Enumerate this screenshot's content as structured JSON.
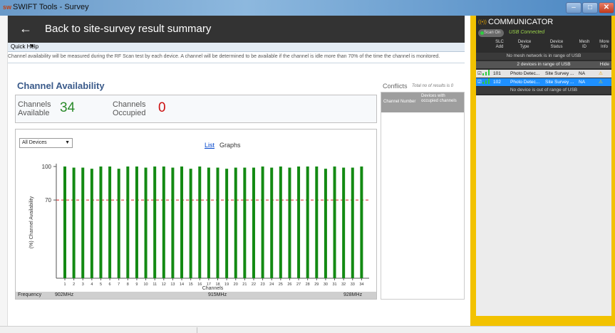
{
  "window": {
    "title": "SWIFT Tools - Survey",
    "app_icon": "swift-logo-icon"
  },
  "header": {
    "back_label": "Back to site-survey result summary",
    "back_icon": "arrow-left-icon"
  },
  "quick_help": {
    "label": "Quick Help",
    "help_text": "Channel availability will be measured during the RF Scan test by each device. A channel will be determined to be available if the channel is idle more than 70% of the time the channel is monitored."
  },
  "availability": {
    "title": "Channel Availability",
    "available_label": "Channels Available",
    "available_value": "34",
    "occupied_label": "Channels Occupied",
    "occupied_value": "0"
  },
  "conflicts": {
    "title": "Conflicts",
    "total_text": "Total no of results is 0",
    "col_channel": "Channel Number",
    "col_devices": "Devices with occupied channels"
  },
  "chart_controls": {
    "device_filter": "All Devices",
    "tab_list": "List",
    "tab_graphs": "Graphs"
  },
  "frequency": {
    "label": "Frequency",
    "start": "902MHz",
    "mid": "915MHz",
    "end": "928MHz"
  },
  "chart_data": {
    "type": "bar",
    "categories": [
      "1",
      "2",
      "3",
      "4",
      "5",
      "6",
      "7",
      "8",
      "9",
      "10",
      "11",
      "12",
      "13",
      "14",
      "15",
      "16",
      "17",
      "18",
      "19",
      "20",
      "21",
      "22",
      "23",
      "24",
      "25",
      "26",
      "27",
      "28",
      "29",
      "30",
      "31",
      "32",
      "33",
      "34"
    ],
    "values": [
      100,
      99,
      99,
      98,
      100,
      100,
      98,
      100,
      100,
      99,
      100,
      100,
      99,
      100,
      98,
      100,
      99,
      99,
      98,
      99,
      99,
      99,
      100,
      99,
      100,
      99,
      100,
      100,
      100,
      98,
      100,
      99,
      99,
      100
    ],
    "xlabel": "Channels",
    "ylabel": "(%) Channel Availability",
    "yticks": [
      100,
      70
    ],
    "threshold": 70,
    "ylim": [
      0,
      100
    ],
    "colors": {
      "bar": "#138a13",
      "threshold": "#d42020"
    }
  },
  "communicator": {
    "title": "COMMUNICATOR",
    "scan_label": "Scan On",
    "usb_status": "USB Connected",
    "columns": [
      "SLC Add",
      "Device Type",
      "Device Status",
      "Mesh ID",
      "More Info"
    ],
    "no_mesh_text": "No mesh network is in range of USB",
    "in_range_text": "2 devices in range of USB",
    "hide_label": "Hide",
    "devices": [
      {
        "slc": "101",
        "type": "Photo Detec...",
        "status": "Site Survey ...",
        "mesh": "NA"
      },
      {
        "slc": "102",
        "type": "Photo Detec...",
        "status": "Site Survey ...",
        "mesh": "NA"
      }
    ],
    "out_of_range_text": "No device is out of range of USB"
  }
}
